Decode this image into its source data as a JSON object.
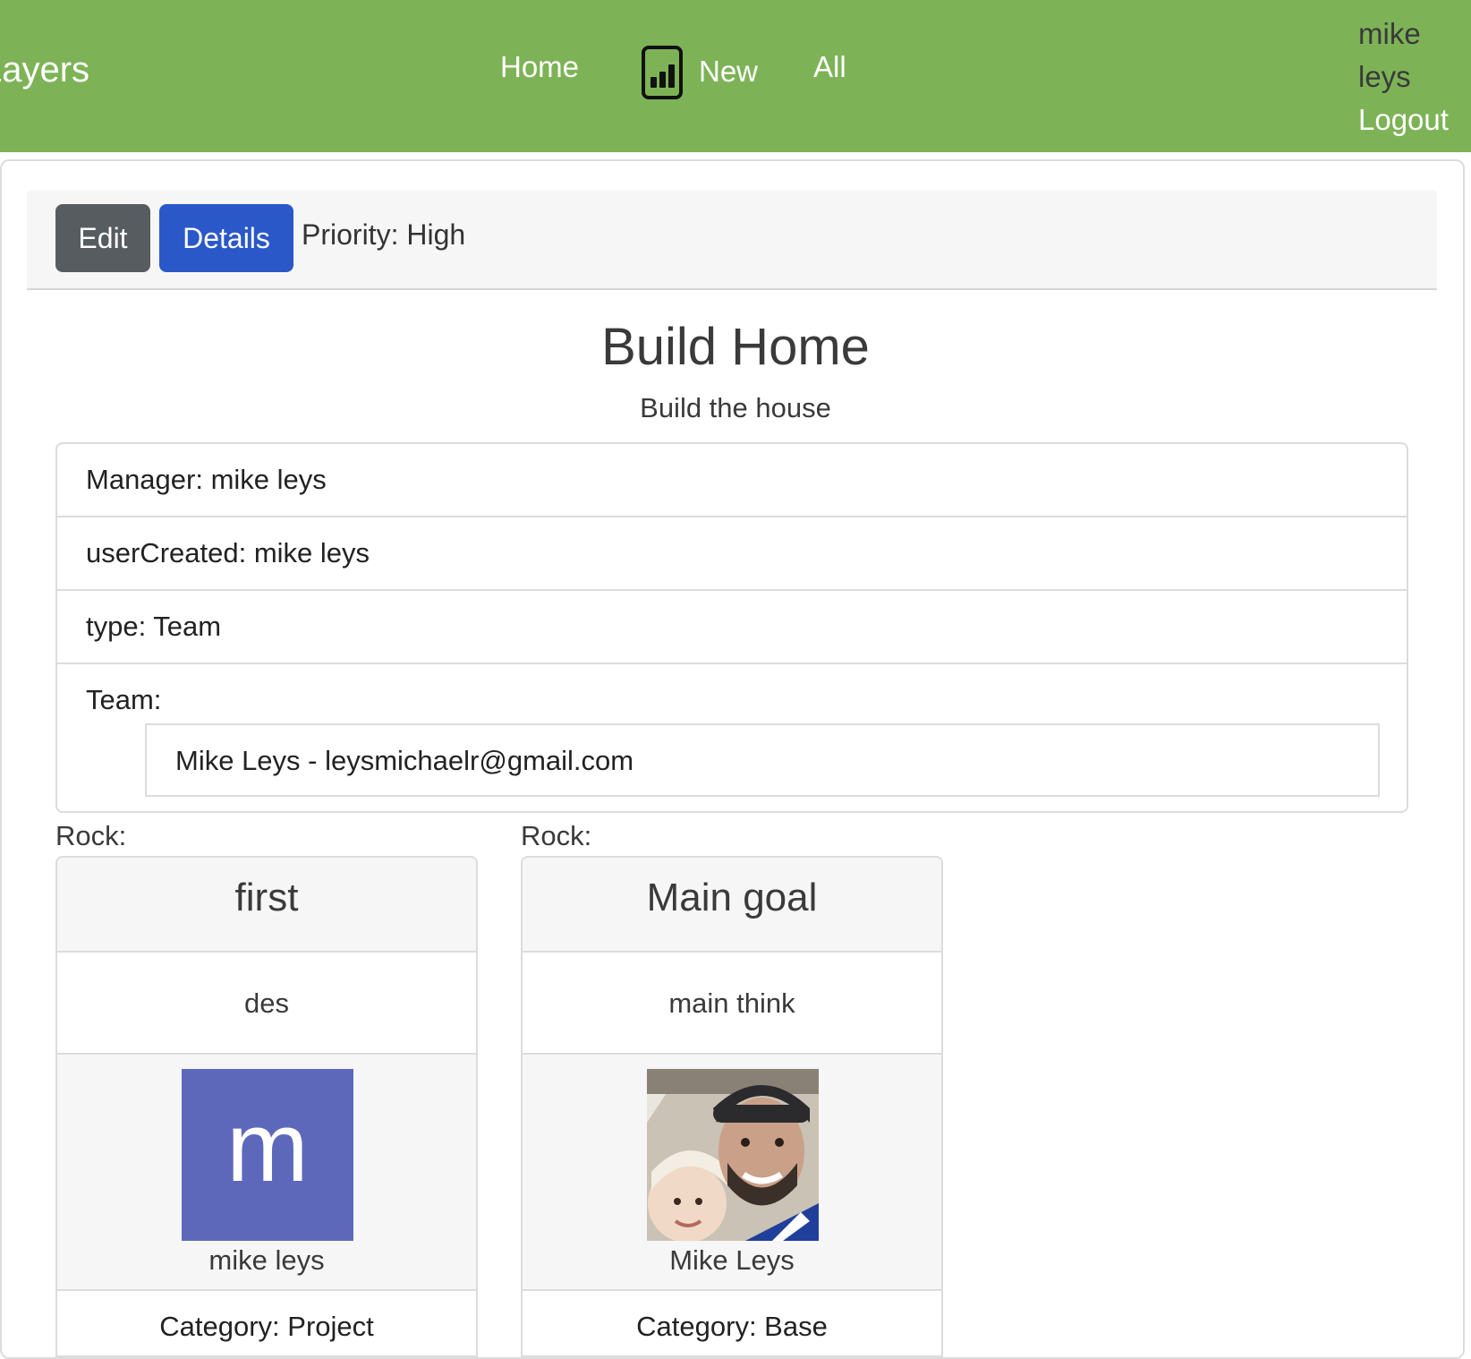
{
  "navbar": {
    "brand": "Layers",
    "links": {
      "home": "Home",
      "new": "New",
      "all": "All"
    },
    "user": {
      "first": "mike",
      "last": "leys",
      "logout": "Logout"
    }
  },
  "toolbar": {
    "edit_label": "Edit",
    "details_label": "Details",
    "priority": "Priority: High"
  },
  "project": {
    "title": "Build Home",
    "subtitle": "Build the house",
    "manager": "Manager: mike leys",
    "user_created": "userCreated: mike leys",
    "type": "type: Team",
    "team_label": "Team:",
    "team_members": [
      "Mike Leys - leysmichaelr@gmail.com"
    ]
  },
  "rocks": [
    {
      "label": "Rock:",
      "title": "first",
      "description": "des",
      "avatar_letter": "m",
      "owner": "mike leys",
      "category": "Category: Project"
    },
    {
      "label": "Rock:",
      "title": "Main goal",
      "description": "main think",
      "avatar_letter": "",
      "owner": "Mike Leys",
      "category": "Category: Base"
    }
  ],
  "colors": {
    "navbar": "#7db356",
    "edit": "#575c61",
    "details": "#2a58c8",
    "avatar": "#5e68bb"
  }
}
